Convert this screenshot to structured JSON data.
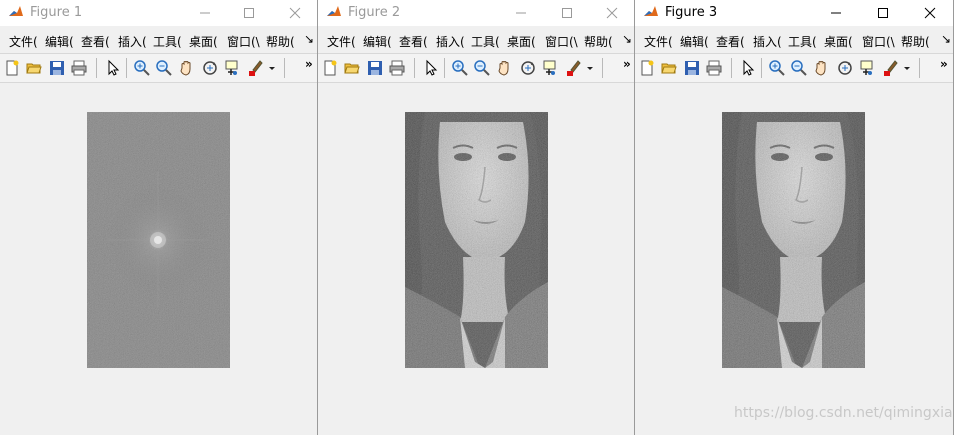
{
  "windows": [
    {
      "title": "Figure 1",
      "active": false,
      "menu": [
        "文件(",
        "编辑(",
        "查看(",
        "插入(",
        "工具(",
        "桌面(",
        "窗口(\\",
        "帮助("
      ],
      "image": "frequency-spectrum"
    },
    {
      "title": "Figure 2",
      "active": false,
      "menu": [
        "文件(",
        "编辑(",
        "查看(",
        "插入(",
        "工具(",
        "桌面(",
        "窗口(\\",
        "帮助("
      ],
      "image": "noisy-portrait"
    },
    {
      "title": "Figure 3",
      "active": true,
      "menu": [
        "文件(",
        "编辑(",
        "查看(",
        "插入(",
        "工具(",
        "桌面(",
        "窗口(\\",
        "帮助("
      ],
      "image": "noisy-portrait"
    }
  ],
  "menu_overflow": "↘",
  "toolbar_overflow": "»",
  "toolbar_icons": [
    "new-figure-icon",
    "open-file-icon",
    "save-icon",
    "print-icon",
    "pointer-icon",
    "zoom-in-icon",
    "zoom-out-icon",
    "pan-hand-icon",
    "rotate-3d-icon",
    "data-cursor-icon",
    "brush-icon",
    "brush-dropdown-icon"
  ],
  "watermark": "https://blog.csdn.net/qimingxia",
  "colors": {
    "titlebar_bg": "#ffffff",
    "inactive_title": "#9a9a9a",
    "active_title": "#000000",
    "window_bg": "#f0f0f0"
  }
}
